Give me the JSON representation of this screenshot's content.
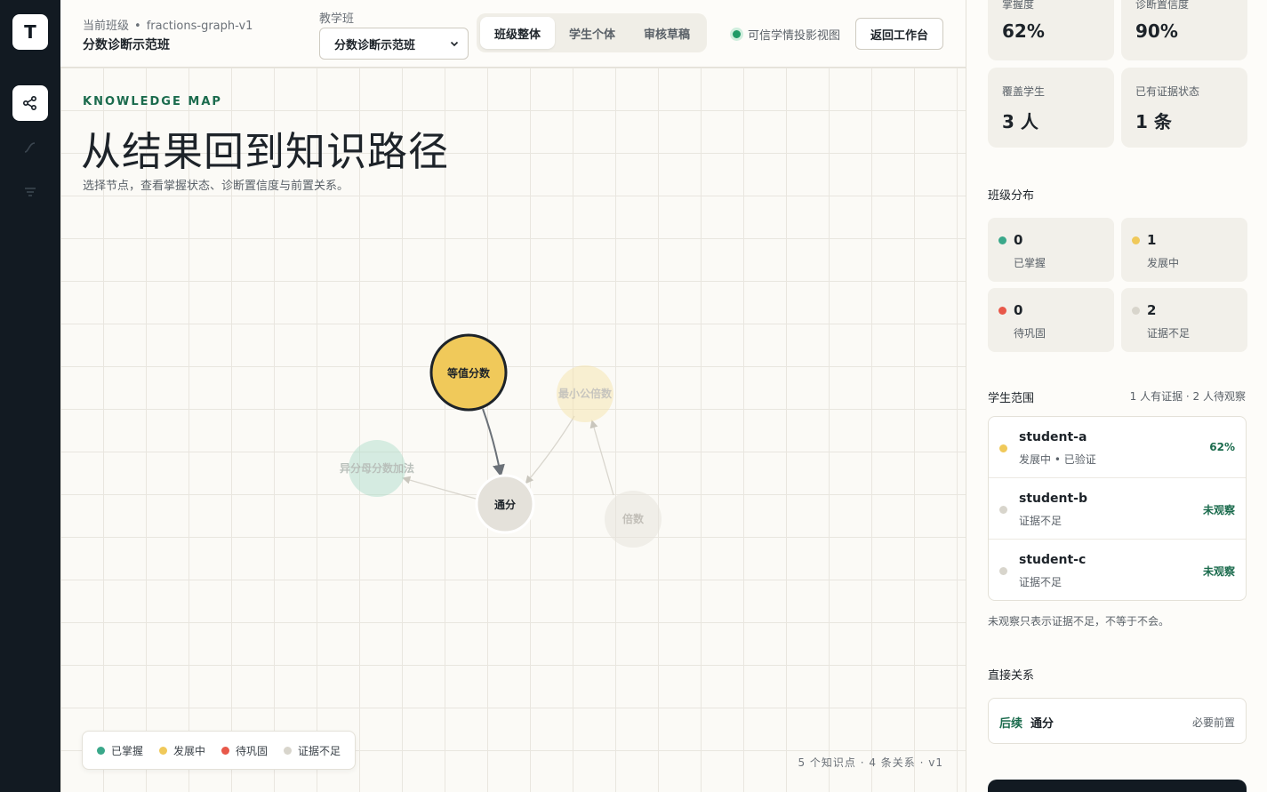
{
  "rail": {
    "logo": "T",
    "items": [
      {
        "icon": "graph-nodes-icon",
        "active": true
      },
      {
        "icon": "trend-curve-icon",
        "active": false
      },
      {
        "icon": "filter-icon",
        "active": false
      }
    ]
  },
  "header": {
    "crumb_label": "当前班级",
    "crumb_sep": "•",
    "crumb_graph": "fractions-graph-v1",
    "class_title": "分数诊断示范班",
    "select_label": "教学班",
    "select_value": "分数诊断示范班",
    "tabs": [
      "班级整体",
      "学生个体",
      "审核草稿"
    ],
    "active_tab": 0,
    "live_label": "可信学情投影视图",
    "back_button": "返回工作台"
  },
  "map": {
    "eyebrow": "KNOWLEDGE MAP",
    "title": "从结果回到知识路径",
    "subtitle": "选择节点，查看掌握状态、诊断置信度与前置关系。",
    "nodes": [
      {
        "label": "等值分数",
        "state": "developing",
        "selected": true
      },
      {
        "label": "最小公倍数",
        "state": "developing",
        "faded": true
      },
      {
        "label": "异分母分数加法",
        "state": "mastered",
        "faded": true
      },
      {
        "label": "通分",
        "state": "insufficient",
        "faded": false
      },
      {
        "label": "倍数",
        "state": "insufficient",
        "faded": true
      }
    ],
    "legend": [
      {
        "label": "已掌握",
        "color": "#3aa88a"
      },
      {
        "label": "发展中",
        "color": "#f0c95a"
      },
      {
        "label": "待巩固",
        "color": "#e8584a"
      },
      {
        "label": "证据不足",
        "color": "#d8d5cc"
      }
    ],
    "stats": "5 个知识点 · 4 条关系 · v1"
  },
  "panel": {
    "metrics": [
      {
        "label": "掌握度",
        "value": "62%"
      },
      {
        "label": "诊断置信度",
        "value": "90%"
      },
      {
        "label": "覆盖学生",
        "value": "3 人"
      },
      {
        "label": "已有证据状态",
        "value": "1 条"
      }
    ],
    "distribution_title": "班级分布",
    "distribution": [
      {
        "count": "0",
        "label": "已掌握",
        "color": "#3aa88a"
      },
      {
        "count": "1",
        "label": "发展中",
        "color": "#f0c95a"
      },
      {
        "count": "0",
        "label": "待巩固",
        "color": "#e8584a"
      },
      {
        "count": "2",
        "label": "证据不足",
        "color": "#d8d5cc"
      }
    ],
    "scope_title": "学生范围",
    "scope_meta": "1 人有证据 · 2 人待观察",
    "students": [
      {
        "name": "student-a",
        "meta": "发展中 • 已验证",
        "score": "62%",
        "color": "#f0c95a"
      },
      {
        "name": "student-b",
        "meta": "证据不足",
        "score": "未观察",
        "color": "#d8d5cc"
      },
      {
        "name": "student-c",
        "meta": "证据不足",
        "score": "未观察",
        "color": "#d8d5cc"
      }
    ],
    "note": "未观察只表示证据不足，不等于不会。",
    "relations_title": "直接关系",
    "relation": {
      "tag": "后续",
      "target": "通分",
      "kind": "必要前置"
    }
  }
}
